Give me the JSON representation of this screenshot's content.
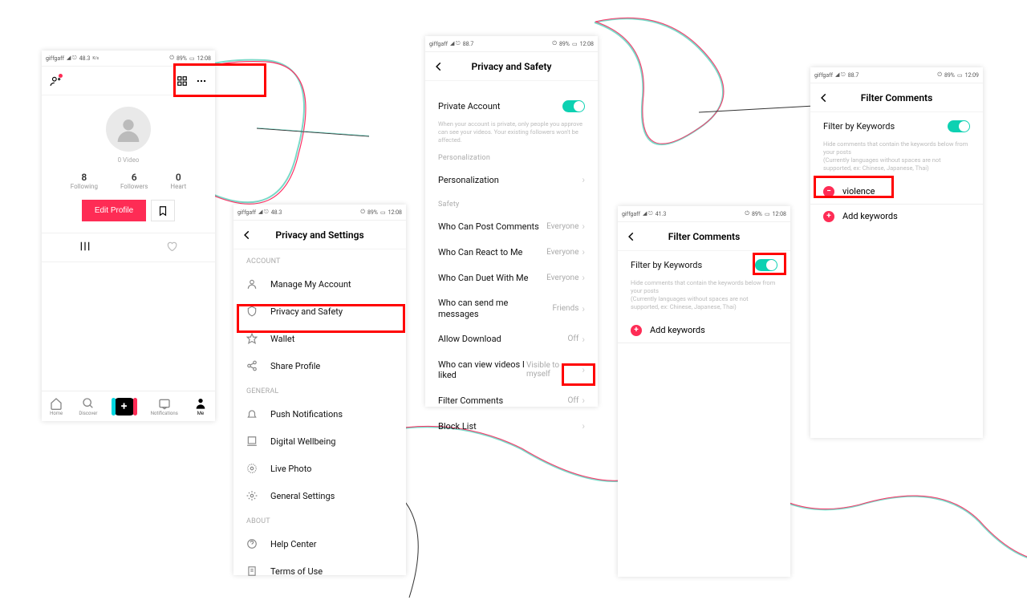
{
  "status": {
    "carrier": "giffgaff",
    "speed": "48.3",
    "speed_unit": "K/s",
    "battery": "89%",
    "time": "12:08",
    "time2": "12:09",
    "speed2": "88.7",
    "speed3": "41.3"
  },
  "s1": {
    "video_count": "0 Video",
    "stats": [
      {
        "n": "8",
        "l": "Following"
      },
      {
        "n": "6",
        "l": "Followers"
      },
      {
        "n": "0",
        "l": "Heart"
      }
    ],
    "edit": "Edit Profile",
    "nav": [
      "Home",
      "Discover",
      "",
      "Notifications",
      "Me"
    ]
  },
  "s2": {
    "title": "Privacy and Settings",
    "sec_account": "ACCOUNT",
    "rows_account": [
      "Manage My Account",
      "Privacy and Safety",
      "Wallet",
      "Share Profile"
    ],
    "sec_general": "GENERAL",
    "rows_general": [
      "Push Notifications",
      "Digital Wellbeing",
      "Live Photo",
      "General Settings"
    ],
    "sec_about": "ABOUT",
    "rows_about": [
      "Help Center",
      "Terms of Use"
    ]
  },
  "s3": {
    "title": "Privacy and Safety",
    "private": "Private Account",
    "private_sub": "When your account is private, only people you approve can see your videos. Your existing followers won't be affected.",
    "pers_hdr": "Personalization",
    "pers_row": "Personalization",
    "safety_hdr": "Safety",
    "rows": [
      {
        "l": "Who Can Post Comments",
        "v": "Everyone"
      },
      {
        "l": "Who Can React to Me",
        "v": "Everyone"
      },
      {
        "l": "Who Can Duet With Me",
        "v": "Everyone"
      },
      {
        "l": "Who can send me messages",
        "v": "Friends",
        "two": true
      },
      {
        "l": "Allow Download",
        "v": "Off"
      },
      {
        "l": "Who can view videos I liked",
        "v": "Visible to myself",
        "two": true
      },
      {
        "l": "Filter Comments",
        "v": "Off"
      },
      {
        "l": "Block List",
        "v": ""
      }
    ]
  },
  "s4": {
    "title": "Filter Comments",
    "flt": "Filter by Keywords",
    "sub": "Hide comments that contain the keywords below from your posts\n(Currently languages without spaces are not supported, ex: Chinese, Japanese, Thai)",
    "add": "Add keywords"
  },
  "s5": {
    "title": "Filter Comments",
    "flt": "Filter by Keywords",
    "sub": "Hide comments that contain the keywords below from your posts\n(Currently languages without spaces are not supported, ex: Chinese, Japanese, Thai)",
    "kw": "violence",
    "add": "Add keywords"
  }
}
